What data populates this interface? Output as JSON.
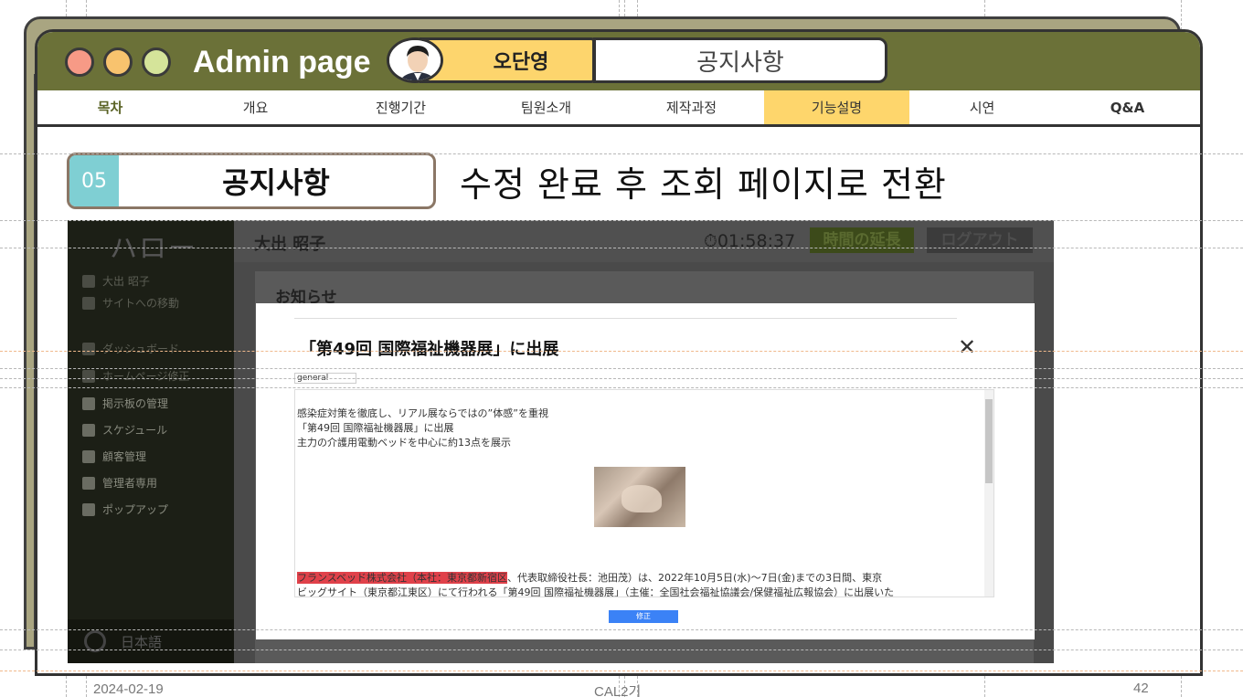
{
  "window": {
    "title": "Admin page",
    "author": "오단영",
    "section_title": "공지사항"
  },
  "nav": {
    "items": [
      {
        "label": "목차"
      },
      {
        "label": "개요"
      },
      {
        "label": "진행기간"
      },
      {
        "label": "팀원소개"
      },
      {
        "label": "제작과정"
      },
      {
        "label": "기능설명"
      },
      {
        "label": "시연"
      },
      {
        "label": "Q&A"
      }
    ],
    "active_label": "기능설명"
  },
  "section": {
    "number": "05",
    "name": "공지사항",
    "description": "수정 완료 후 조회 페이지로 전환"
  },
  "screenshot": {
    "logo": "ハロー",
    "user_name": "大出 昭子",
    "timer": "01:58:37",
    "extend_button": "時間の延長",
    "logout_button": "ログアウト",
    "sidebar": {
      "profile_name": "大出 昭子",
      "site_link": "サイトへの移動",
      "items": [
        {
          "label": "ダッシュボード"
        },
        {
          "label": "ホームページ修正"
        },
        {
          "label": "掲示板の管理"
        },
        {
          "label": "スケジュール"
        },
        {
          "label": "顧客管理"
        },
        {
          "label": "管理者専用"
        },
        {
          "label": "ポップアップ"
        }
      ],
      "language": "日本語"
    },
    "panel_title": "お知らせ",
    "modal": {
      "title": "「第49回 国際福祉機器展」に出展",
      "close": "✕",
      "category": "general",
      "body_lines": [
        "感染症対策を徹底し、リアル展ならではの”体感”を重視",
        "「第49回 国際福祉機器展」に出展",
        "主力の介護用電動ベッドを中心に約13点を展示"
      ],
      "highlight": "フランスベッド株式会社（本社：東京都新宿区",
      "para_line1_rest": "、代表取締役社長：池田茂）は、2022年10月5日(水)～7日(金)までの3日間、東京",
      "para_line2": "ビッグサイト（東京都江東区）にて行われる「第49回 国際福祉機器展」（主催：全国社会福祉協議会/保健福祉広報協会）に出展いた",
      "submit": "修正"
    }
  },
  "footer": {
    "date": "2024-02-19",
    "center": "CAL2기",
    "page": "42"
  },
  "colors": {
    "titlebar": "#6b7138",
    "accent_yellow": "#fed66c",
    "section_number_bg": "#7fcfd3"
  }
}
